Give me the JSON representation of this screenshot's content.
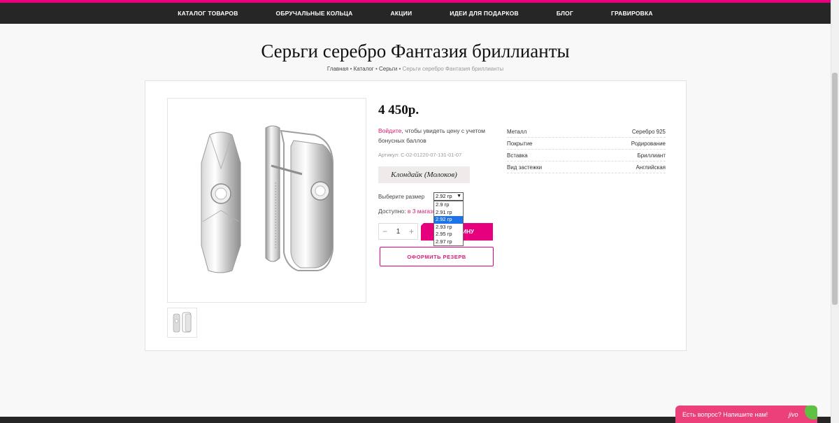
{
  "topnav": {
    "items": [
      "КАТАЛОГ ТОВАРОВ",
      "ОБРУЧАЛЬНЫЕ КОЛЬЦА",
      "АКЦИИ",
      "ИДЕИ ДЛЯ ПОДАРКОВ",
      "БЛОГ",
      "ГРАВИРОВКА"
    ]
  },
  "page": {
    "title": "Серьги серебро Фантазия бриллианты",
    "breadcrumb": {
      "items": [
        "Главная",
        "Каталог",
        "Серьги"
      ],
      "current": "Серьги серебро Фантазия бриллианты",
      "separator": "•"
    }
  },
  "product": {
    "price": "4 450р.",
    "login_link": "Войдите",
    "login_text": ", чтобы увидеть цену с учетом бонусных баллов",
    "article": "Артикул: С-02-01220-07-131-01-07",
    "supplier": "Клондайк (Молоков)",
    "size_label": "Выберите размер",
    "size_selected": "2.92 гр",
    "size_options": [
      "2.9 гр",
      "2.91 гр",
      "2.92 гр",
      "2.93 гр",
      "2.95 гр",
      "2.97 гр"
    ],
    "availability_label": "Доступно:",
    "availability_link": "в 3 магазинах",
    "quantity": "1",
    "qty_minus": "−",
    "qty_plus": "+",
    "cart_button": "В КОРЗИНУ",
    "cart_button_visible": "ЗИНУ",
    "reserve_button": "ОФОРМИТЬ РЕЗЕРВ"
  },
  "specs": [
    {
      "name": "Металл",
      "value": "Серебро 925"
    },
    {
      "name": "Покрытие",
      "value": "Родирование"
    },
    {
      "name": "Вставка",
      "value": "Бриллиант"
    },
    {
      "name": "Вид застежки",
      "value": "Английская"
    }
  ],
  "chat": {
    "text": "Есть вопрос? Напишите нам!",
    "brand": "jivo"
  },
  "colors": {
    "accent": "#e6007e",
    "topbar": "#262626",
    "selected_option": "#1e73e8"
  },
  "icons": [
    "earring-image",
    "earring-thumbnail",
    "minus-icon",
    "plus-icon",
    "chevron-down-icon",
    "chat-status-icon"
  ]
}
